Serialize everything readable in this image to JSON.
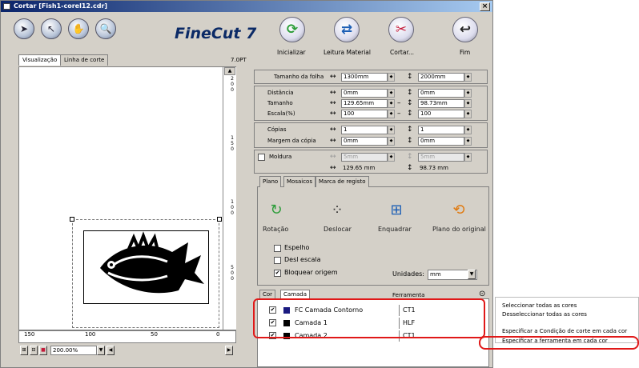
{
  "window": {
    "title": "Cortar [Fish1-corel12.cdr]",
    "close": "×"
  },
  "logo": "FineCut 7",
  "tools": [
    {
      "icon": "arrow-select-icon",
      "glyph": "➤"
    },
    {
      "icon": "arrow-node-icon",
      "glyph": "↖"
    },
    {
      "icon": "hand-icon",
      "glyph": "✋"
    },
    {
      "icon": "zoom-icon",
      "glyph": "🔍"
    }
  ],
  "actions": [
    {
      "label": "Inicializar",
      "icon": "refresh-icon",
      "glyph": "⟳",
      "color": "#2e9d3b"
    },
    {
      "label": "Leitura Material",
      "icon": "swap-icon",
      "glyph": "⇄",
      "color": "#1d5fb5"
    },
    {
      "label": "Cortar...",
      "icon": "cutter-icon",
      "glyph": "✂",
      "color": "#c41a3a"
    },
    {
      "label": "Fim",
      "icon": "return-icon",
      "glyph": "↩",
      "color": "#222222"
    }
  ],
  "view_tabs": [
    "Visualização",
    "Linha de corte"
  ],
  "version": "7.0PT",
  "ruler_v": [
    "2",
    "0",
    "0",
    "1",
    "5",
    "0",
    "1",
    "0",
    "0",
    "5",
    "0",
    "0"
  ],
  "ruler_h": [
    "150",
    "100",
    "50",
    "0"
  ],
  "zoom": "200.00%",
  "sheet": {
    "label": "Tamanho da folha",
    "w": "1300mm",
    "h": "2000mm"
  },
  "distance": {
    "label": "Distância",
    "w": "0mm",
    "h": "0mm"
  },
  "size": {
    "label": "Tamanho",
    "w": "129.65mm",
    "h": "98.73mm"
  },
  "scale": {
    "label": "Escala(%)",
    "w": "100",
    "h": "100"
  },
  "copies": {
    "label": "Cópias",
    "w": "1",
    "h": "1"
  },
  "margin": {
    "label": "Margem da cópia",
    "w": "0mm",
    "h": "0mm"
  },
  "frame": {
    "label": "Moldura",
    "w": "5mm",
    "h": "5mm"
  },
  "total": {
    "w": "129.65 mm",
    "h": "98.73 mm"
  },
  "plan_tabs": [
    "Plano",
    "Mosaicos",
    "Marca de registo"
  ],
  "plan_buttons": [
    {
      "label": "Rotação",
      "icon": "rotate-icon",
      "glyph": "↻",
      "color": "#2e9d3b"
    },
    {
      "label": "Deslocar",
      "icon": "move-icon",
      "glyph": "⁘",
      "color": "#333333"
    },
    {
      "label": "Enquadrar",
      "icon": "fit-icon",
      "glyph": "⊞",
      "color": "#1d5fb5"
    },
    {
      "label": "Plano do original",
      "icon": "original-plan-icon",
      "glyph": "⟲",
      "color": "#e07a10"
    }
  ],
  "checks": [
    {
      "label": "Espelho",
      "checked": false
    },
    {
      "label": "Desl escala",
      "checked": false
    },
    {
      "label": "Bloquear origem",
      "checked": true
    }
  ],
  "units": {
    "label": "Unidades:",
    "value": "mm"
  },
  "color_tabs": [
    "Cor",
    "Camada"
  ],
  "tool_header": "Ferramenta",
  "layers": [
    {
      "name": "FC Camada Contorno",
      "tool": "CT1",
      "color": "#1a1a80",
      "checked": true
    },
    {
      "name": "Camada 1",
      "tool": "HLF",
      "color": "#000000",
      "checked": true
    },
    {
      "name": "Camada 2",
      "tool": "CT1",
      "color": "#000000",
      "checked": true
    }
  ],
  "context_menu": [
    "Seleccionar todas as cores",
    "Desseleccionar todas as cores",
    "Especificar a Condição de corte em cada cor",
    "Especificar a ferramenta em cada cor"
  ]
}
